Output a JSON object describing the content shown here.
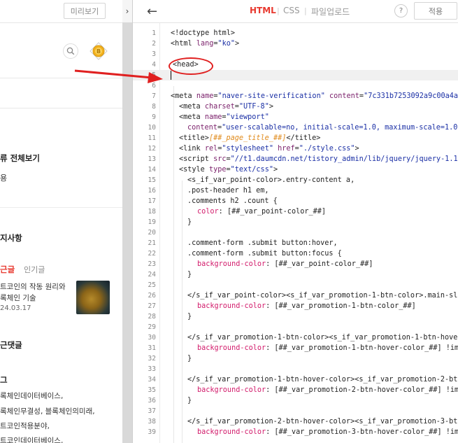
{
  "preview": {
    "button_label": "미리보기",
    "collapse_glyph": "›",
    "sidebar": {
      "category_all": "류 전체보기",
      "category_sub": "용",
      "notice": "지사항",
      "tab_recent": "근글",
      "tab_popular": "인기글",
      "post_title_1": "트코인의 작동 원리와",
      "post_title_2": "록체인 기술",
      "post_date": "24.03.17",
      "recent_comments": "근댓글",
      "tags_header": "그",
      "tag_1": "록체인데이터베이스,",
      "tag_2": "록체인무결성,  블록체인의미래,",
      "tag_3": "트코인적용분야,",
      "tag_4": "트코인데이터베이스,"
    },
    "icons": {
      "search": "search-icon",
      "badge": "coin-badge-icon"
    },
    "badge_letter": "B"
  },
  "editor": {
    "back_icon": "back-arrow-icon",
    "back_glyph": "←",
    "tabs": {
      "html": "HTML",
      "css": "CSS",
      "upload": "파일업로드",
      "separator": "|"
    },
    "help_label": "?",
    "apply_label": "적용",
    "accent_color": "#e8392f",
    "lines": [
      {
        "n": "1"
      },
      {
        "n": "2"
      },
      {
        "n": "3"
      },
      {
        "n": "4"
      },
      {
        "n": "5"
      },
      {
        "n": "6"
      },
      {
        "n": "7"
      },
      {
        "n": "8"
      },
      {
        "n": "9"
      },
      {
        "n": "10"
      },
      {
        "n": "11"
      },
      {
        "n": "12"
      },
      {
        "n": "13"
      },
      {
        "n": "14"
      },
      {
        "n": "15"
      },
      {
        "n": "16"
      },
      {
        "n": "17"
      },
      {
        "n": "18"
      },
      {
        "n": "19"
      },
      {
        "n": "20"
      },
      {
        "n": "21"
      },
      {
        "n": "22"
      },
      {
        "n": "23"
      },
      {
        "n": "24"
      },
      {
        "n": "25"
      },
      {
        "n": "26"
      },
      {
        "n": "27"
      },
      {
        "n": "28"
      },
      {
        "n": "29"
      },
      {
        "n": "30"
      },
      {
        "n": "31"
      },
      {
        "n": "32"
      },
      {
        "n": "33"
      },
      {
        "n": "34"
      },
      {
        "n": "35"
      },
      {
        "n": "36"
      },
      {
        "n": "37"
      },
      {
        "n": "38"
      },
      {
        "n": "39"
      }
    ],
    "code": {
      "l1": "<!doctype html>",
      "l2a": "<html ",
      "l2b": "lang",
      "l2c": "=",
      "l2d": "\"ko\"",
      "l2e": ">",
      "l4": "<head>",
      "l7a": "<meta ",
      "l7b": "name",
      "l7c": "=",
      "l7d": "\"naver-site-verification\"",
      "l7e": " content",
      "l7f": "=",
      "l7g": "\"7c331b7253092a9c00a4a",
      "l8a": "<meta ",
      "l8b": "charset",
      "l8c": "=",
      "l8d": "\"UTF-8\"",
      "l8e": ">",
      "l9a": "<meta ",
      "l9b": "name",
      "l9c": "=",
      "l9d": "\"viewport\"",
      "l10a": "content",
      "l10b": "=",
      "l10c": "\"user-scalable=no, initial-scale=1.0, maximum-scale=1.0",
      "l11a": "<title>",
      "l11b": "[##_page_title_##]",
      "l11c": "</title>",
      "l12a": "<link ",
      "l12b": "rel",
      "l12c": "=",
      "l12d": "\"stylesheet\"",
      "l12e": " href",
      "l12f": "=",
      "l12g": "\"./style.css\"",
      "l12h": ">",
      "l13a": "<script ",
      "l13b": "src",
      "l13c": "=",
      "l13d": "\"//t1.daumcdn.net/tistory_admin/lib/jquery/jquery-1.1",
      "l14a": "<style ",
      "l14b": "type",
      "l14c": "=",
      "l14d": "\"text/css\"",
      "l14e": ">",
      "l15": "<s_if_var_point-color>.entry-content a,",
      "l16": ".post-header h1 em,",
      "l17": ".comments h2 .count {",
      "l18a": "color",
      "l18b": ": [##_var_point-color_##]",
      "l19": "}",
      "l21": ".comment-form .submit button:hover,",
      "l22": ".comment-form .submit button:focus {",
      "l23a": "background-color",
      "l23b": ": [##_var_point-color_##]",
      "l24": "}",
      "l26": "</s_if_var_point-color><s_if_var_promotion-1-btn-color>.main-sl",
      "l27a": "background-color",
      "l27b": ": [##_var_promotion-1-btn-color_##]",
      "l28": "}",
      "l30": "</s_if_var_promotion-1-btn-color><s_if_var_promotion-1-btn-hove",
      "l31a": "background-color",
      "l31b": ": [##_var_promotion-1-btn-hover-color_##] !im",
      "l32": "}",
      "l34": "</s_if_var_promotion-1-btn-hover-color><s_if_var_promotion-2-bt",
      "l35a": "background-color",
      "l35b": ": [##_var_promotion-2-btn-hover-color_##] !im",
      "l36": "}",
      "l38": "</s_if_var_promotion-2-btn-hover-color><s_if_var_promotion-3-bt",
      "l39a": "background-color",
      "l39b": ": [##_var_promotion-3-btn-hover-color_##] !im"
    }
  },
  "annotation": {
    "circle_color": "#e02020",
    "arrow_color": "#e02020"
  }
}
